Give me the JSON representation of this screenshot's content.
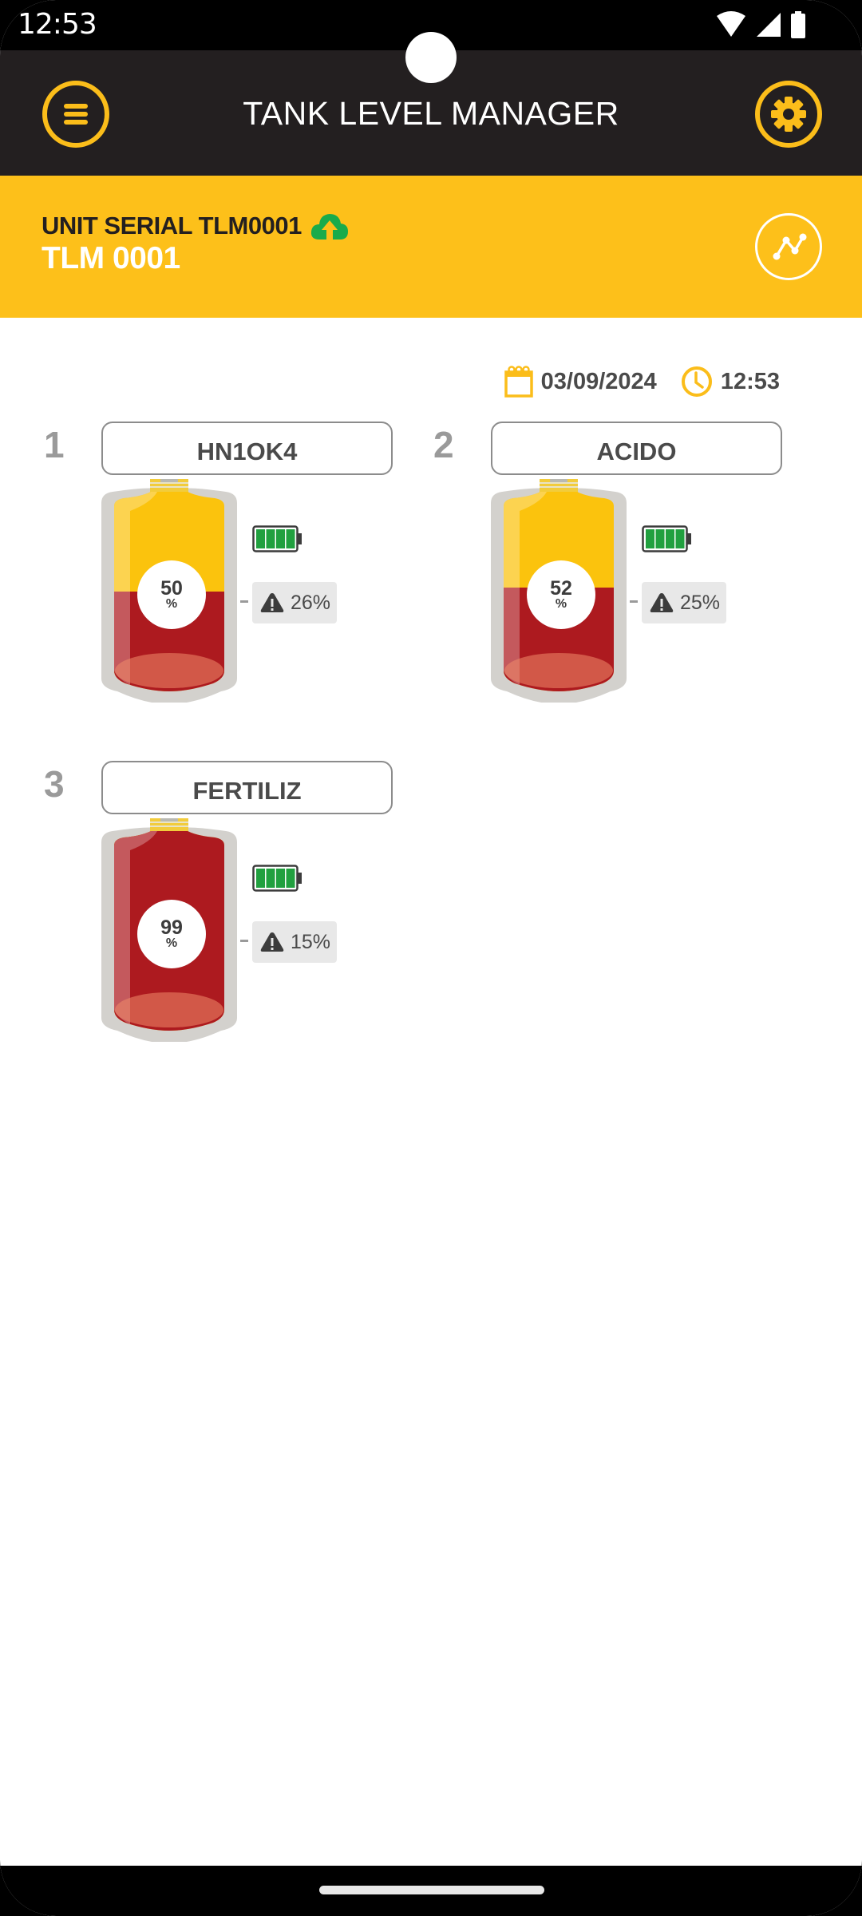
{
  "status_bar": {
    "time": "12:53",
    "icons": [
      "wifi-icon",
      "cellular-signal-icon",
      "battery-icon"
    ]
  },
  "app_bar": {
    "title": "TANK LEVEL MANAGER",
    "menu_icon": "menu-icon",
    "settings_icon": "gear-icon"
  },
  "unit": {
    "serial_label": "UNIT SERIAL TLM0001",
    "name": "TLM 0001",
    "sync_icon": "cloud-upload-icon",
    "chart_icon": "chart-line-icon"
  },
  "datetime": {
    "date": "03/09/2024",
    "time": "12:53",
    "date_icon": "calendar-icon",
    "time_icon": "clock-icon"
  },
  "colors": {
    "accent_yellow": "#fdc01a",
    "app_bar_dark": "#231f20",
    "sync_green": "#1aab4b",
    "liquid_red": "#ad1a1f",
    "empty_yellow": "#fbc30d",
    "battery_green": "#21a03f"
  },
  "tanks": [
    {
      "index": "1",
      "name": "HN1OK4",
      "level": "50",
      "level_fraction": 0.5,
      "level_unit": "%",
      "battery_bars": 4,
      "alarm_label": "26%",
      "alarm_dash": "-"
    },
    {
      "index": "2",
      "name": "ACIDO",
      "level": "52",
      "level_fraction": 0.52,
      "level_unit": "%",
      "battery_bars": 4,
      "alarm_label": "25%",
      "alarm_dash": "-"
    },
    {
      "index": "3",
      "name": "FERTILIZ",
      "level": "99",
      "level_fraction": 0.99,
      "level_unit": "%",
      "battery_bars": 4,
      "alarm_label": "15%",
      "alarm_dash": "-"
    }
  ]
}
